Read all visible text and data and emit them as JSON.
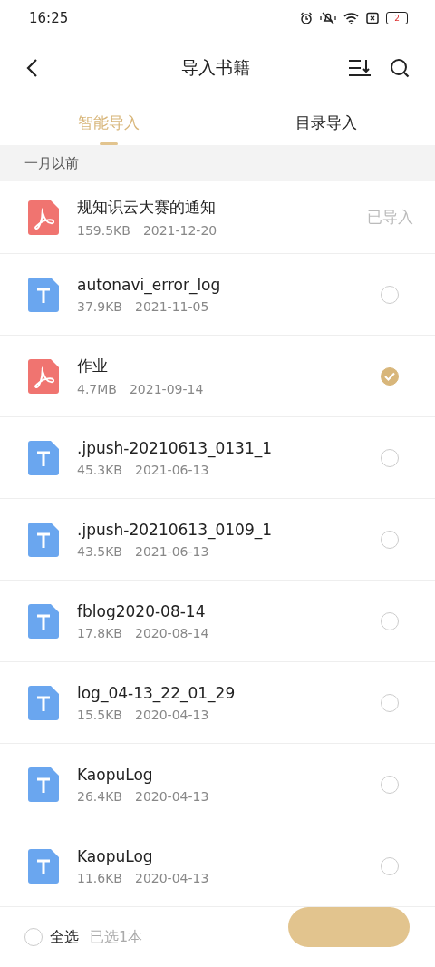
{
  "status_bar": {
    "time": "16:25",
    "battery": "2"
  },
  "header": {
    "title": "导入书籍"
  },
  "tabs": [
    {
      "label": "智能导入",
      "selected": true
    },
    {
      "label": "目录导入",
      "selected": false
    }
  ],
  "section": {
    "label": "一月以前"
  },
  "files": [
    {
      "kind": "pdf",
      "name": "规知识云大赛的通知",
      "size": "159.5KB",
      "date": "2021-12-20",
      "status": "已导入"
    },
    {
      "kind": "txt",
      "name": "autonavi_error_log",
      "size": "37.9KB",
      "date": "2021-11-05",
      "selected": false
    },
    {
      "kind": "pdf",
      "name": "作业",
      "size": "4.7MB",
      "date": "2021-09-14",
      "selected": true
    },
    {
      "kind": "txt",
      "name": ".jpush-20210613_0131_1",
      "size": "45.3KB",
      "date": "2021-06-13",
      "selected": false
    },
    {
      "kind": "txt",
      "name": ".jpush-20210613_0109_1",
      "size": "43.5KB",
      "date": "2021-06-13",
      "selected": false
    },
    {
      "kind": "txt",
      "name": "fblog2020-08-14",
      "size": "17.8KB",
      "date": "2020-08-14",
      "selected": false
    },
    {
      "kind": "txt",
      "name": "log_04-13_22_01_29",
      "size": "15.5KB",
      "date": "2020-04-13",
      "selected": false
    },
    {
      "kind": "txt",
      "name": "KaopuLog",
      "size": "26.4KB",
      "date": "2020-04-13",
      "selected": false
    },
    {
      "kind": "txt",
      "name": "KaopuLog",
      "size": "11.6KB",
      "date": "2020-04-13",
      "selected": false
    }
  ],
  "footer": {
    "select_all": {
      "label": "全选",
      "checked": false
    },
    "count": "已选1本"
  }
}
